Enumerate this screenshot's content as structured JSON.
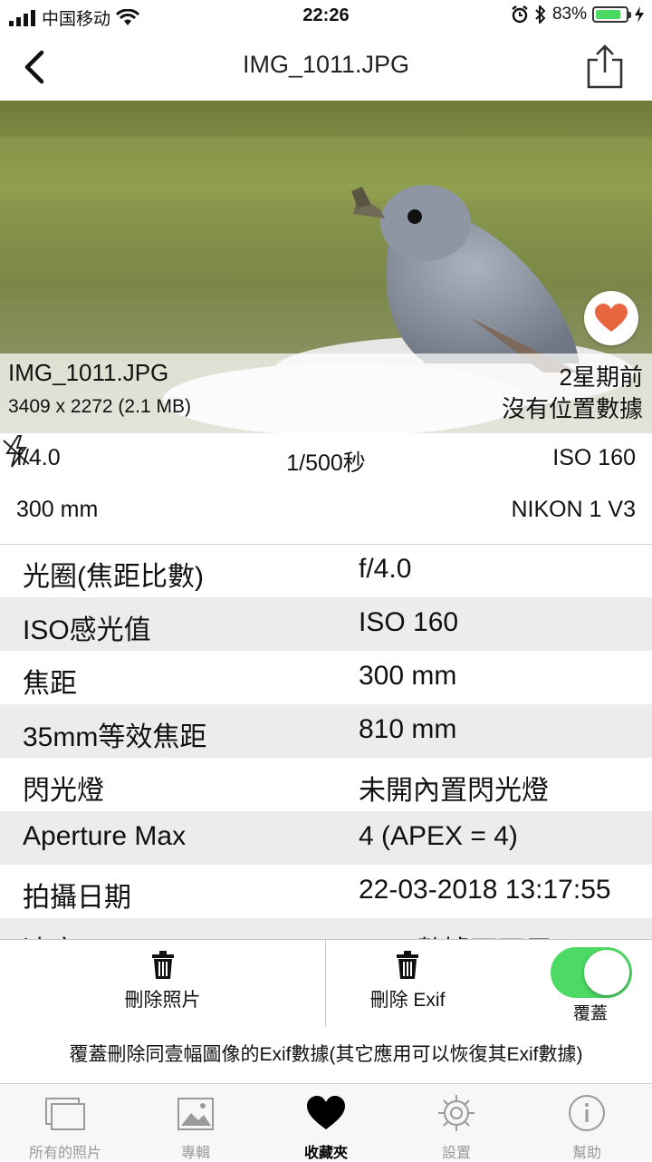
{
  "status_bar": {
    "carrier": "中国移动",
    "time": "22:26",
    "battery": "83%",
    "battery_level": 0.83
  },
  "nav": {
    "title": "IMG_1011.JPG",
    "back_icon": "chevron-left-icon",
    "share_icon": "share-icon"
  },
  "photo": {
    "filename": "IMG_1011.JPG",
    "dimensions": "3409 x 2272 (2.1 MB)",
    "time_ago": "2星期前",
    "location": "沒有位置數據",
    "favorite_icon": "heart-icon",
    "favorite_color": "#e8663d"
  },
  "summary": {
    "aperture": "f/4.0",
    "shutter": "1/500秒",
    "iso": "ISO 160",
    "focal": "300 mm",
    "flash_icon": "flash-off-icon",
    "camera": "NIKON 1 V3"
  },
  "exif_rows": [
    {
      "key": "光圈(焦距比數)",
      "value": "f/4.0"
    },
    {
      "key": "ISO感光值",
      "value": "ISO 160"
    },
    {
      "key": "焦距",
      "value": "300 mm"
    },
    {
      "key": "35mm等效焦距",
      "value": "810 mm"
    },
    {
      "key": "閃光燈",
      "value": "未開內置閃光燈"
    },
    {
      "key": "Aperture Max",
      "value": "4 (APEX = 4)"
    },
    {
      "key": "拍攝日期",
      "value": "22-03-2018 13:17:55"
    },
    {
      "key": "速度",
      "value": "GPS數據不可用"
    }
  ],
  "actions": {
    "delete_photo": "刪除照片",
    "delete_exif": "刪除 Exif",
    "overwrite_label": "覆蓋",
    "overwrite_on": true,
    "toggle_color": "#4cd964"
  },
  "note": "覆蓋刪除同壹幅圖像的Exif數據(其它應用可以恢復其Exif數據)",
  "tabs": [
    {
      "label": "所有的照片",
      "icon": "photos-stack-icon",
      "active": false
    },
    {
      "label": "專輯",
      "icon": "album-icon",
      "active": false
    },
    {
      "label": "收藏夾",
      "icon": "heart-icon",
      "active": true
    },
    {
      "label": "設置",
      "icon": "gear-icon",
      "active": false
    },
    {
      "label": "幫助",
      "icon": "info-icon",
      "active": false
    }
  ]
}
